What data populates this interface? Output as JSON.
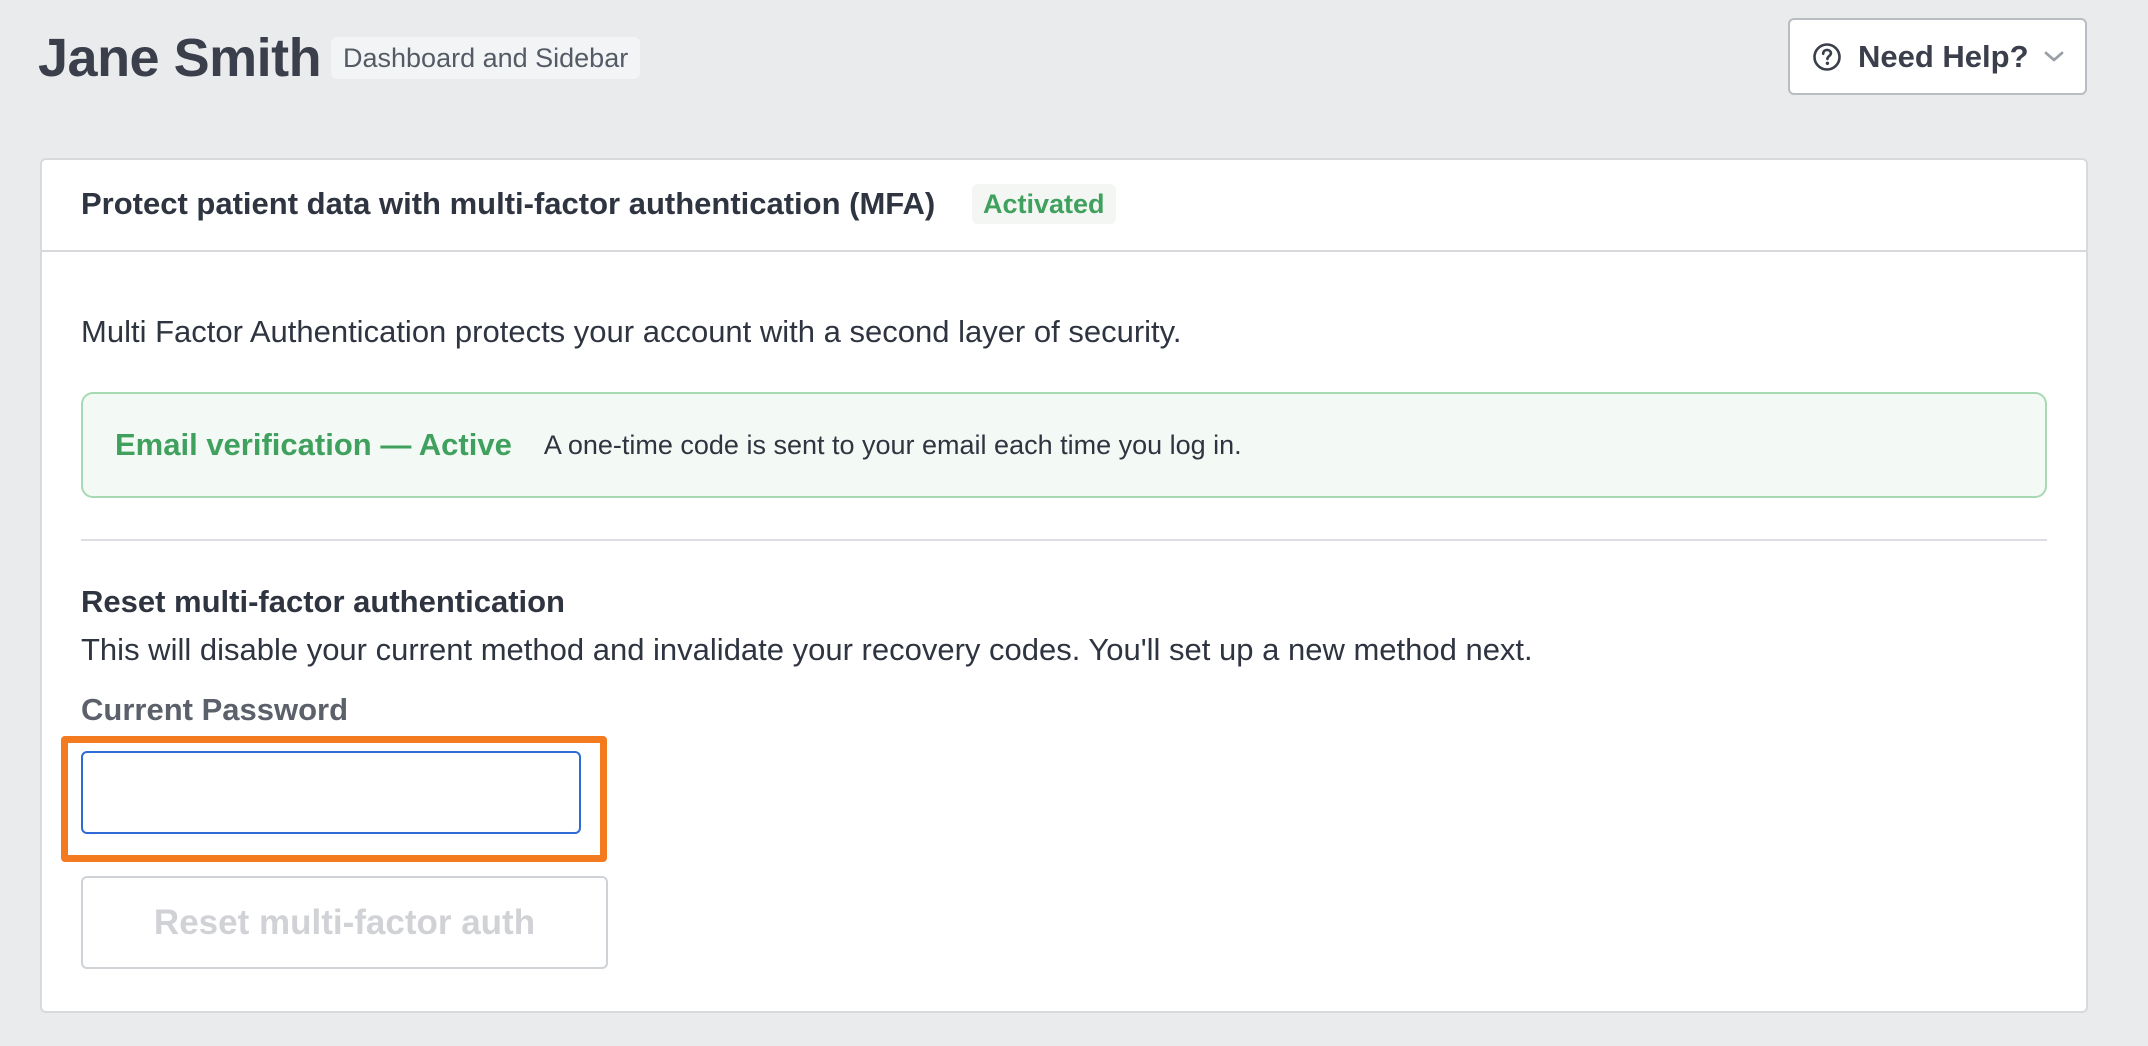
{
  "header": {
    "title": "Jane Smith",
    "context_badge": "Dashboard and Sidebar",
    "help_button_label": "Need Help?"
  },
  "mfa_card": {
    "title": "Protect patient data with multi-factor authentication (MFA)",
    "status": "Activated",
    "status_color": "#3fa15d",
    "intro": "Multi Factor Authentication protects your account with a second layer of security.",
    "active_method": {
      "label": "Email verification — Active",
      "description": "A one-time code is sent to your email each time you log in."
    },
    "reset": {
      "heading": "Reset multi-factor authentication",
      "description": "This will disable your current method and invalidate your recovery codes. You'll set up a new method next.",
      "password_label": "Current Password",
      "password_value": "",
      "button_label": "Reset multi-factor auth",
      "button_enabled": false
    }
  },
  "icons": {
    "help": "question-circle-icon",
    "dropdown": "chevron-down-icon"
  },
  "colors": {
    "background": "#eaebed",
    "accent_input": "#2f6bd4",
    "highlight": "#f47a1f",
    "success": "#3fa15d"
  }
}
